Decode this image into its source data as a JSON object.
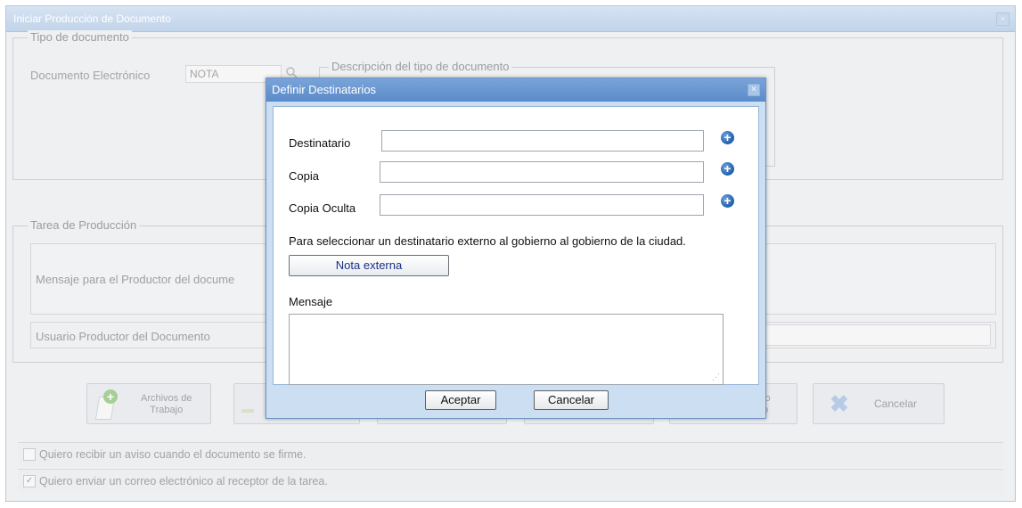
{
  "background": {
    "window_title": "Iniciar Producción de Documento",
    "close_glyph": "×",
    "tipo_legend": "Tipo de documento",
    "doc_label": "Documento Electrónico",
    "doc_value": "NOTA",
    "desc_legend": "Descripción del tipo de documento",
    "tarea_legend": "Tarea de Producción",
    "mensaje_productor_label": "Mensaje para el Productor del docume",
    "usuario_productor_label": "Usuario Productor del Documento",
    "buttons": {
      "archivos_line1": "Archivos de",
      "archivos_line2": "Trabajo",
      "fifth_line1": "lo",
      "fifth_line2": "o",
      "cancelar": "Cancelar"
    },
    "checkbox_aviso": "Quiero recibir un aviso cuando el documento se firme.",
    "checkbox_correo": "Quiero enviar un correo electrónico al receptor de la tarea.",
    "checkbox_aviso_checked": false,
    "checkbox_correo_checked": true
  },
  "modal": {
    "title": "Definir Destinatarios",
    "close_glyph": "×",
    "destinatario_label": "Destinatario",
    "destinatario_value": "",
    "copia_label": "Copia",
    "copia_value": "",
    "copia_oculta_label": "Copia Oculta",
    "copia_oculta_value": "",
    "plus_glyph": "+",
    "info_text": "Para seleccionar un destinatario externo al gobierno al gobierno de la ciudad.",
    "nota_externa_button": "Nota externa",
    "mensaje_label": "Mensaje",
    "mensaje_value": "",
    "aceptar_button": "Aceptar",
    "cancelar_button": "Cancelar"
  },
  "colors": {
    "modal_title_bg": "#5b8bcb",
    "modal_frame": "#ccdff2",
    "plus_icon": "#1f5ea8",
    "nota_externa_text": "#1a2f8a"
  },
  "icons": [
    "search-icon",
    "close-icon",
    "plus-circle-icon",
    "add-file-icon",
    "cancel-x-icon",
    "resize-grip-icon",
    "checkbox-icon"
  ]
}
